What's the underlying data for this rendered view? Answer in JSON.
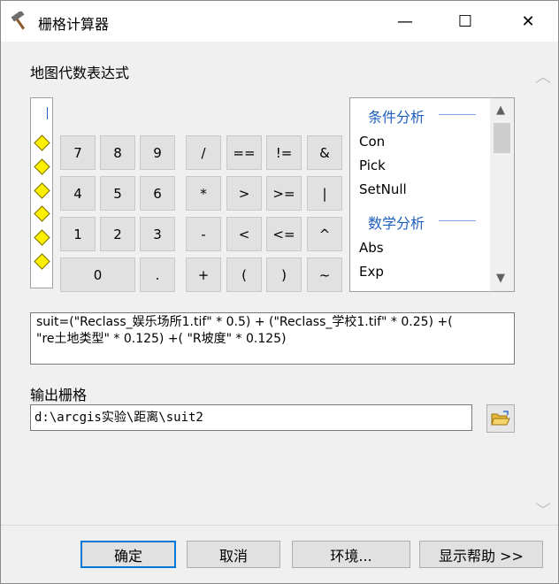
{
  "window": {
    "title": "栅格计算器",
    "minimize_glyph": "—",
    "maximize_glyph": "☐",
    "close_glyph": "✕"
  },
  "expression_section": {
    "label": "地图代数表达式"
  },
  "keypad": {
    "row1": [
      "7",
      "8",
      "9",
      "/",
      "==",
      "!=",
      "&"
    ],
    "row2": [
      "4",
      "5",
      "6",
      "*",
      ">",
      ">=",
      "|"
    ],
    "row3": [
      "1",
      "2",
      "3",
      "-",
      "<",
      "<=",
      "^"
    ],
    "row4": [
      "0",
      ".",
      "+",
      "(",
      ")",
      "~"
    ]
  },
  "function_list": {
    "groups": [
      {
        "header": "条件分析",
        "items": [
          "Con",
          "Pick",
          "SetNull"
        ]
      },
      {
        "header": "数学分析",
        "items": [
          "Abs",
          "Exp"
        ]
      }
    ]
  },
  "expression": {
    "line1": "suit=(\"Reclass_娱乐场所1.tif\" * 0.5) + (\"Reclass_学校1.tif\" * 0.25) +(",
    "line2": "\"re土地类型\" * 0.125) +( \"R坡度\" * 0.125)"
  },
  "output": {
    "label": "输出栅格",
    "value": "d:\\arcgis实验\\距离\\suit2"
  },
  "buttons": {
    "ok": "确定",
    "cancel": "取消",
    "environments": "环境...",
    "show_help": "显示帮助 >>"
  }
}
